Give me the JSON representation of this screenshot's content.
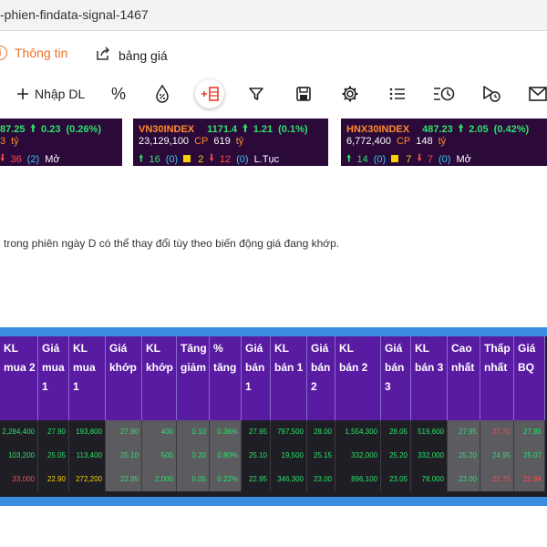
{
  "browser": {
    "url_fragment": "-phien-findata-signal-1467"
  },
  "tabs": [
    {
      "label": "Thông tin",
      "icon": "info-icon",
      "active": true
    },
    {
      "label": "bảng giá",
      "icon": "external-link-icon",
      "active": false
    }
  ],
  "toolbar": {
    "import_label": "Nhập DL",
    "percent_label": "%"
  },
  "indices": [
    {
      "name": "",
      "value": "87.25",
      "change": "0.23",
      "pct": "(0.26%)",
      "volume": "",
      "volume_unit": "",
      "value_traded": "3",
      "value_unit": "tỷ",
      "up": "",
      "up_count": "",
      "ref": "",
      "ref_count": "",
      "down": "36",
      "down_count": "(2)",
      "status": "Mở"
    },
    {
      "name": "VN30INDEX",
      "value": "1171.4",
      "change": "1.21",
      "pct": "(0.1%)",
      "volume": "23,129,100",
      "volume_unit": "CP",
      "value_traded": "619",
      "value_unit": "tỷ",
      "up": "16",
      "up_count": "(0)",
      "ref": "2",
      "ref_count": "",
      "down": "12",
      "down_count": "(0)",
      "status": "L.Tục"
    },
    {
      "name": "HNX30INDEX",
      "value": "487.23",
      "change": "2.05",
      "pct": "(0.42%)",
      "volume": "6,772,400",
      "volume_unit": "CP",
      "value_traded": "148",
      "value_unit": "tỷ",
      "up": "14",
      "up_count": "(0)",
      "ref": "7",
      "ref_count": "",
      "down": "7",
      "down_count": "(0)",
      "status": "Mở"
    }
  ],
  "note": "trong phiên ngày D có thể thay đổi tùy theo biến động giá đang khớp.",
  "columns": [
    {
      "label": "KL\nmua 2"
    },
    {
      "label": "Giá\nmua\n1"
    },
    {
      "label": "KL\nmua\n1"
    },
    {
      "label": "Giá\nkhớp"
    },
    {
      "label": "KL\nkhớp"
    },
    {
      "label": "Tăng\ngiảm"
    },
    {
      "label": "%\ntăng"
    },
    {
      "label": "Giá\nbán\n1"
    },
    {
      "label": "KL\nbán 1"
    },
    {
      "label": "Giá\nbán\n2"
    },
    {
      "label": "KL\nbán 2"
    },
    {
      "label": "Giá\nbán\n3"
    },
    {
      "label": "KL\nbán 3"
    },
    {
      "label": "Cao\nnhất"
    },
    {
      "label": "Thấp\nnhất"
    },
    {
      "label": "Giá\nBQ"
    }
  ],
  "rows": [
    [
      "2,284,400",
      "27.90",
      "193,800",
      "27.90",
      "400",
      "0.10",
      "0.36%",
      "27.95",
      "797,500",
      "28.00",
      "1,554,300",
      "28.05",
      "519,600",
      "27.95",
      "27.70",
      "27.85"
    ],
    [
      "103,200",
      "25.05",
      "113,400",
      "25.10",
      "500",
      "0.20",
      "0.80%",
      "25.10",
      "19,500",
      "25.15",
      "332,000",
      "25.20",
      "332,000",
      "25.20",
      "24.95",
      "25.07"
    ],
    [
      "33,000",
      "22.90",
      "272,200",
      "22.95",
      "2,000",
      "0.05",
      "0.22%",
      "22.95",
      "346,300",
      "23.00",
      "896,100",
      "23.05",
      "78,000",
      "23.00",
      "22.75",
      "22.84"
    ]
  ],
  "colors": {
    "up": "#2ee06b",
    "down": "#ff4b4b",
    "ref": "#f5d300",
    "header": "#5a1ba3",
    "index_bg": "#2b0a3a",
    "board_border": "#3a8de0",
    "tab_active": "#e8712b"
  }
}
